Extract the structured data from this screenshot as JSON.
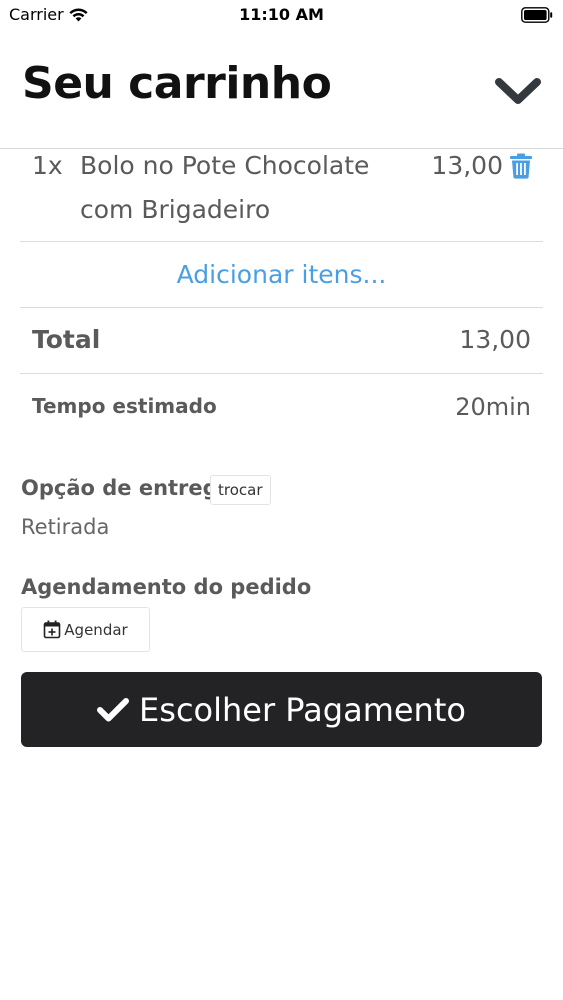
{
  "status_bar": {
    "carrier": "Carrier",
    "time": "11:10 AM",
    "icons": [
      "wifi-icon",
      "battery-icon"
    ]
  },
  "header": {
    "title": "Seu carrinho",
    "collapse_icon": "chevron-down-icon"
  },
  "cart": {
    "items": [
      {
        "quantity": "1x",
        "name": "Bolo no Pote Chocolate com Brigadeiro",
        "price": "13,00",
        "delete_icon": "trash-icon"
      }
    ],
    "add_items_label": "Adicionar itens...",
    "total_label": "Total",
    "total_value": "13,00",
    "estimated_time_label": "Tempo estimado",
    "estimated_time_value": "20min"
  },
  "delivery": {
    "label": "Opção de entrega",
    "change_label": "trocar",
    "value": "Retirada"
  },
  "scheduling": {
    "label": "Agendamento do pedido",
    "button_label": "Agendar",
    "button_icon": "calendar-plus-icon"
  },
  "checkout": {
    "button_label": "Escolher Pagamento",
    "button_icon": "check-icon"
  },
  "colors": {
    "link": "#4a9fe3",
    "primary_button": "#232224",
    "trash_icon": "#4a9fe3"
  }
}
